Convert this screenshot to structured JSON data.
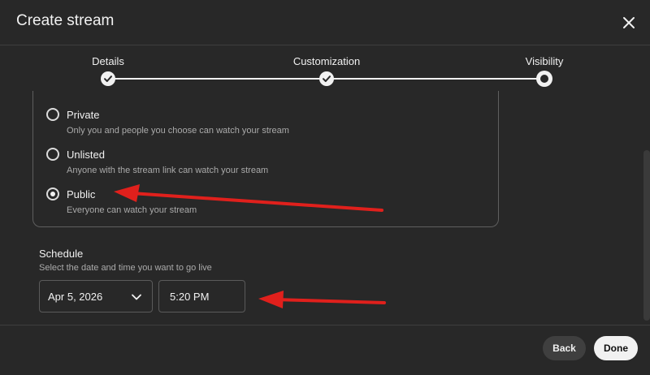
{
  "dialog": {
    "title": "Create stream"
  },
  "stepper": {
    "steps": [
      {
        "label": "Details",
        "state": "completed"
      },
      {
        "label": "Customization",
        "state": "completed"
      },
      {
        "label": "Visibility",
        "state": "current"
      }
    ]
  },
  "visibility": {
    "options": [
      {
        "label": "Private",
        "description": "Only you and people you choose can watch your stream",
        "selected": false
      },
      {
        "label": "Unlisted",
        "description": "Anyone with the stream link can watch your stream",
        "selected": false
      },
      {
        "label": "Public",
        "description": "Everyone can watch your stream",
        "selected": true
      }
    ]
  },
  "schedule": {
    "title": "Schedule",
    "description": "Select the date and time you want to go live",
    "date": "Apr 5, 2026",
    "time": "5:20 PM"
  },
  "footer": {
    "back_label": "Back",
    "done_label": "Done"
  },
  "colors": {
    "background": "#282828",
    "annotation_arrow": "#e0201c"
  },
  "icons": {
    "close": "close-icon",
    "check": "checkmark-icon",
    "dropdown": "chevron-down-icon"
  }
}
